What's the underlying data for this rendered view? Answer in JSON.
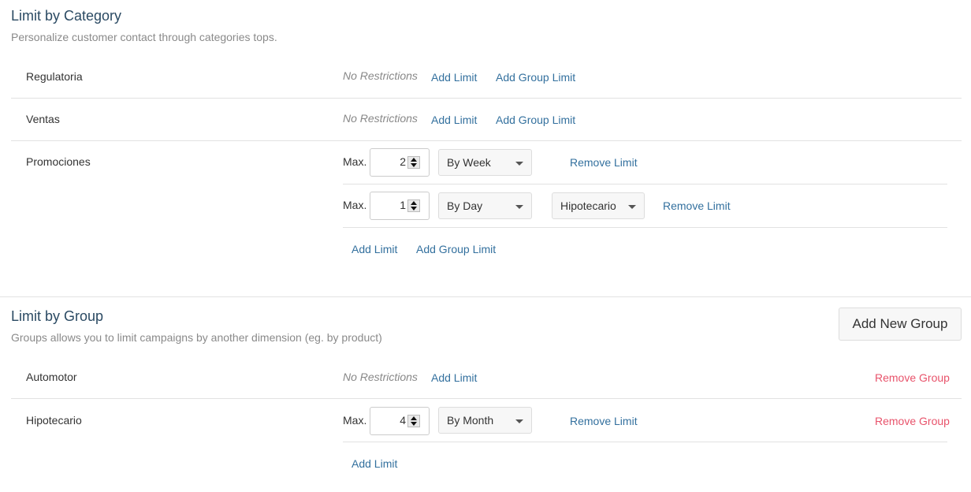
{
  "category_section": {
    "title": "Limit by Category",
    "subtitle": "Personalize customer contact through categories tops.",
    "rows": [
      {
        "name": "Regulatoria",
        "status": "No Restrictions",
        "add_limit": "Add Limit",
        "add_group_limit": "Add Group Limit"
      },
      {
        "name": "Ventas",
        "status": "No Restrictions",
        "add_limit": "Add Limit",
        "add_group_limit": "Add Group Limit"
      },
      {
        "name": "Promociones",
        "limits": [
          {
            "max_label": "Max.",
            "value": "2",
            "period": "By Week",
            "remove": "Remove Limit"
          },
          {
            "max_label": "Max.",
            "value": "1",
            "period": "By Day",
            "group": "Hipotecario",
            "remove": "Remove Limit"
          }
        ],
        "add_limit": "Add Limit",
        "add_group_limit": "Add Group Limit"
      }
    ]
  },
  "group_section": {
    "title": "Limit by Group",
    "subtitle": "Groups allows you to limit campaigns by another dimension (eg. by product)",
    "add_new_group": "Add New Group",
    "rows": [
      {
        "name": "Automotor",
        "status": "No Restrictions",
        "add_limit": "Add Limit",
        "remove_group": "Remove Group"
      },
      {
        "name": "Hipotecario",
        "limits": [
          {
            "max_label": "Max.",
            "value": "4",
            "period": "By Month",
            "remove": "Remove Limit"
          }
        ],
        "add_limit": "Add Limit",
        "remove_group": "Remove Group"
      }
    ]
  },
  "colors": {
    "link": "#33709e",
    "danger": "#e8536b",
    "title": "#2b4a63"
  }
}
